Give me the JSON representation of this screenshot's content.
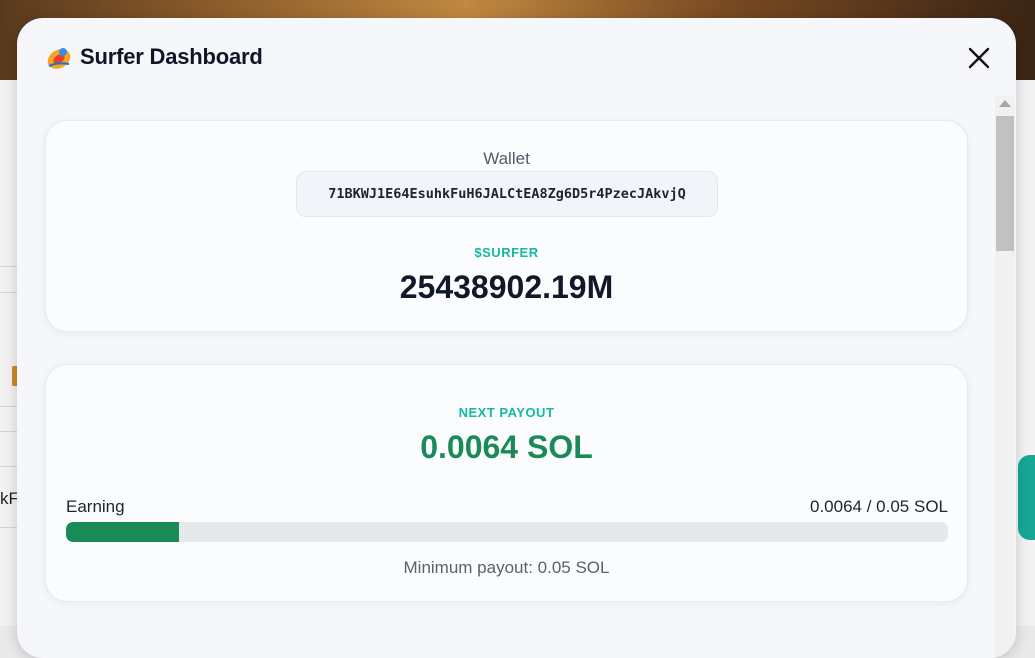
{
  "modal": {
    "title": "Surfer Dashboard",
    "logo_icon": "surfer-logo-icon",
    "close_icon": "close-icon"
  },
  "wallet": {
    "label": "Wallet",
    "address": "71BKWJ1E64EsuhkFuH6JALCtEA8Zg6D5r4PzecJAkvjQ",
    "token_label": "$SURFER",
    "token_value": "25438902.19M"
  },
  "payout": {
    "label": "NEXT PAYOUT",
    "value": "0.0064 SOL",
    "earning_label": "Earning",
    "earning_ratio": "0.0064 / 0.05 SOL",
    "progress_fraction": 0.128,
    "min_payout": "Minimum payout: 0.05 SOL"
  },
  "colors": {
    "accent_teal": "#16b8a2",
    "accent_green": "#1a8a57",
    "title": "#0f1626"
  }
}
